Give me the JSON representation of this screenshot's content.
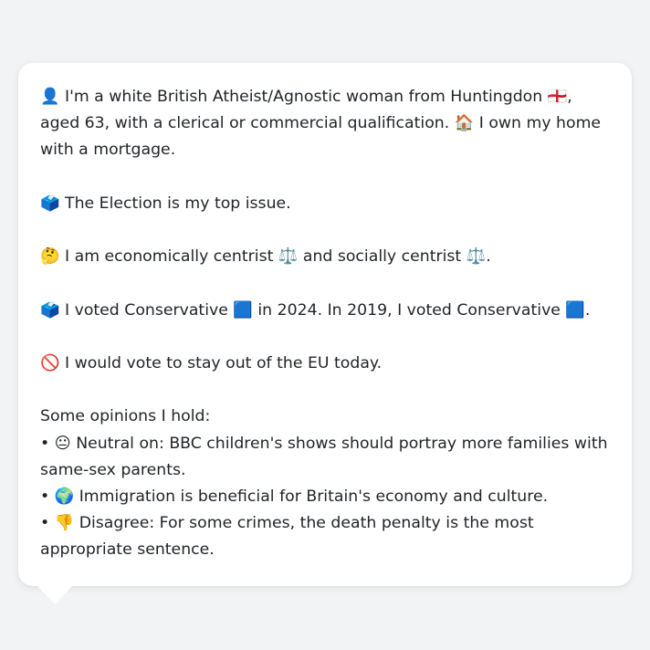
{
  "profile": {
    "intro": "👤 I'm a white British Atheist/Agnostic woman from Huntingdon 🏴󠁧󠁢󠁥󠁮󠁧󠁿, aged 63, with a clerical or commercial qualification. 🏠 I own my home with a mortgage.",
    "top_issue": "🗳️ The Election is my top issue.",
    "ideology": "🤔 I am economically centrist ⚖️ and socially centrist ⚖️.",
    "votes": "🗳️ I voted Conservative 🟦 in 2024. In 2019, I voted Conservative 🟦.",
    "eu": "🚫 I would vote to stay out of the EU today.",
    "opinions_heading": "Some opinions I hold:",
    "opinions": [
      "• 😐 Neutral on: BBC children's shows should portray more families with same-sex parents.",
      "• 🌍 Immigration is beneficial for Britain's economy and culture.",
      "• 👎 Disagree: For some crimes, the death penalty is the most appropriate sentence."
    ]
  }
}
